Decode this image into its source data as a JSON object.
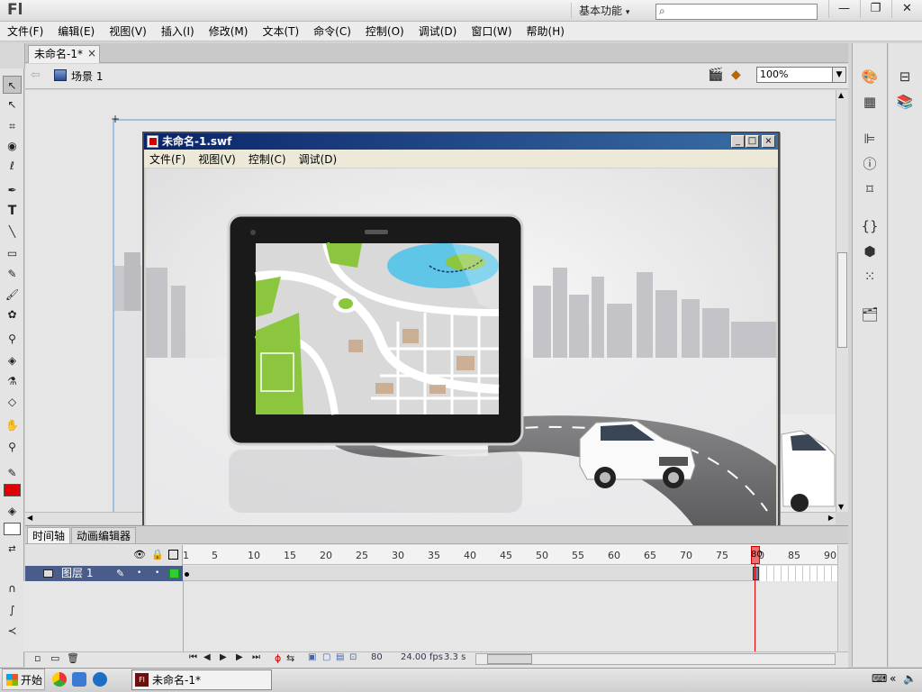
{
  "app": {
    "logo": "Fl",
    "workspace": "基本功能",
    "window_buttons": [
      "—",
      "❐",
      "✕"
    ]
  },
  "menu": [
    "文件(F)",
    "编辑(E)",
    "视图(V)",
    "插入(I)",
    "修改(M)",
    "文本(T)",
    "命令(C)",
    "控制(O)",
    "调试(D)",
    "窗口(W)",
    "帮助(H)"
  ],
  "document": {
    "tab_label": "未命名-1*",
    "tab_close": "×",
    "scene_label": "场景 1",
    "zoom": "100%"
  },
  "swf_window": {
    "title": "未命名-1.swf",
    "buttons": [
      "_",
      "□",
      "×"
    ],
    "menu": [
      "文件(F)",
      "视图(V)",
      "控制(C)",
      "调试(D)"
    ]
  },
  "timeline": {
    "tabs": [
      "时间轴",
      "动画编辑器"
    ],
    "layer_name": "图层 1",
    "ruler_labels": [
      "1",
      "5",
      "10",
      "15",
      "20",
      "25",
      "30",
      "35",
      "40",
      "45",
      "50",
      "55",
      "60",
      "65",
      "70",
      "75",
      "80",
      "85",
      "90"
    ],
    "current_frame": "80",
    "fps": "24.00",
    "fps_unit": "fps",
    "elapsed": "3.3",
    "elapsed_unit": "s"
  },
  "colors": {
    "fill_color": "#e00000",
    "layer_highlight": "#4a5d8a",
    "swf_title_bar": "#0a246a"
  },
  "taskbar": {
    "start_label": "开始",
    "task_item": "未命名-1*"
  }
}
